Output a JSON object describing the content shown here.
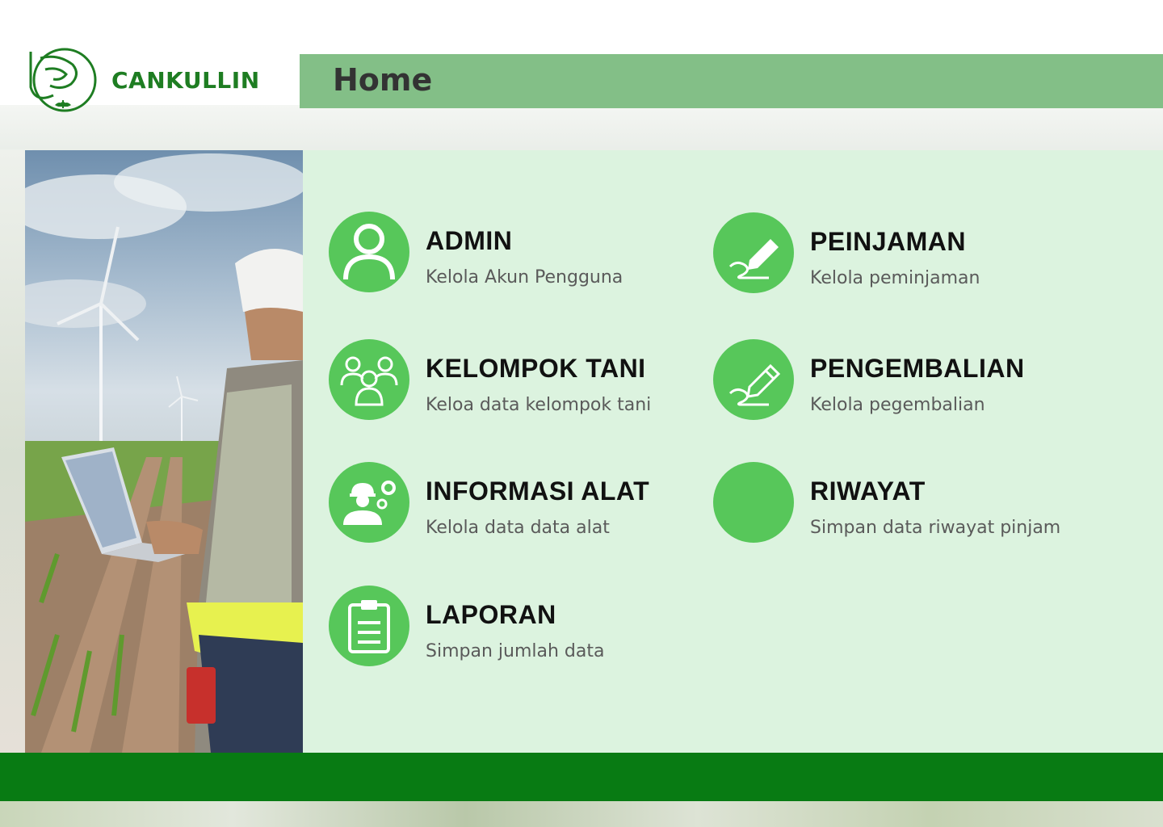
{
  "app": {
    "name": "CANKULLIN"
  },
  "header": {
    "title": "Home"
  },
  "colors": {
    "brand": "#1e7d22",
    "title_bar": "#83bf87",
    "panel": "#dcf3df",
    "icon": "#57c75a",
    "footer": "#087b13"
  },
  "menu": [
    {
      "icon": "user-icon",
      "title": "ADMIN",
      "subtitle": "Kelola Akun Pengguna"
    },
    {
      "icon": "signature-pencil-icon",
      "title": "PEINJAMAN",
      "subtitle": "Kelola peminjaman"
    },
    {
      "icon": "group-icon",
      "title": "KELOMPOK TANI",
      "subtitle": "Keloa data kelompok tani"
    },
    {
      "icon": "pencil-outline-icon",
      "title": "PENGEMBALIAN",
      "subtitle": "Kelola pegembalian"
    },
    {
      "icon": "worker-gears-icon",
      "title": "INFORMASI ALAT",
      "subtitle": "Kelola data data alat"
    },
    {
      "icon": "blank-icon",
      "title": "RIWAYAT",
      "subtitle": "Simpan data riwayat pinjam"
    },
    {
      "icon": "clipboard-icon",
      "title": "LAPORAN",
      "subtitle": "Simpan jumlah data"
    }
  ]
}
